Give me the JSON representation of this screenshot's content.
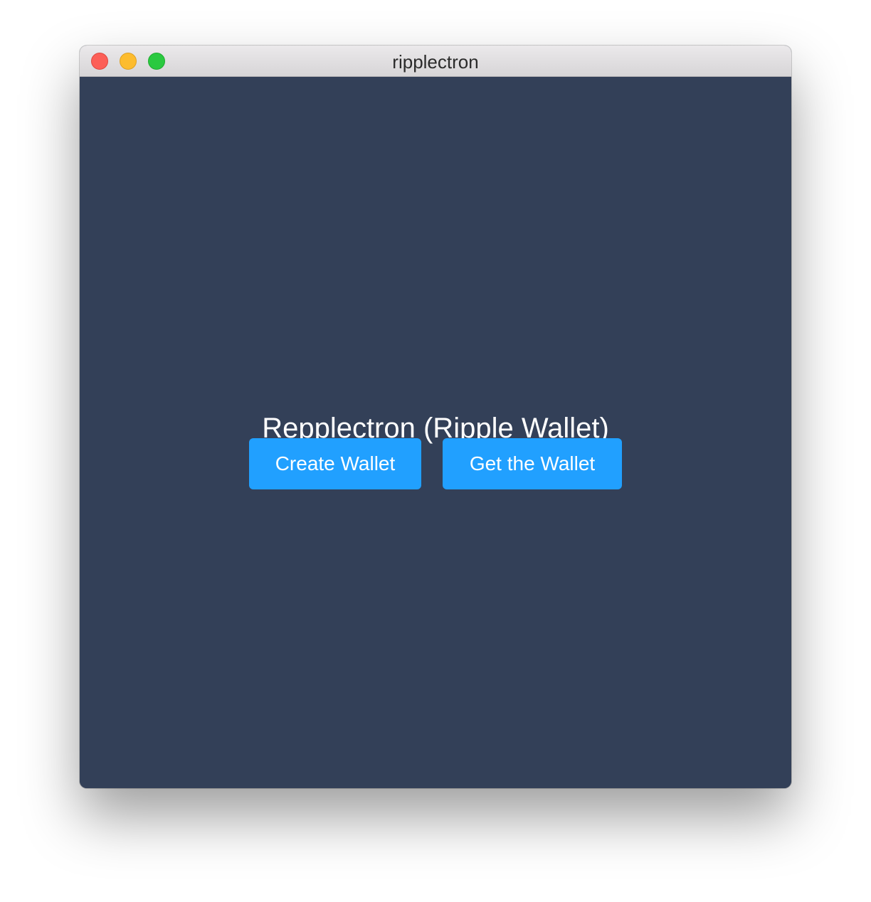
{
  "window": {
    "title": "ripplectron"
  },
  "main": {
    "heading": "Repplectron (Ripple Wallet)",
    "buttons": {
      "create_label": "Create Wallet",
      "get_label": "Get the Wallet"
    }
  },
  "colors": {
    "background": "#334058",
    "button": "#21a0ff",
    "text": "#ffffff"
  }
}
